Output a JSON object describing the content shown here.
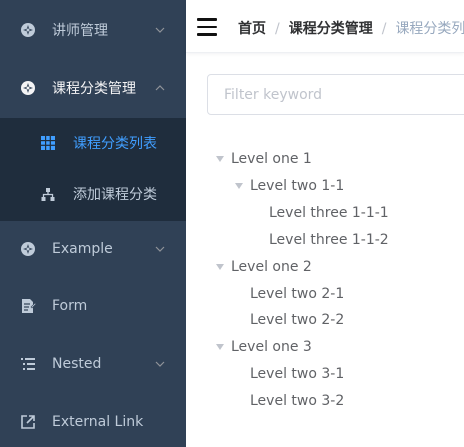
{
  "sidebar": {
    "items": [
      {
        "label": "讲师管理",
        "icon": "example-icon",
        "expanded": false
      },
      {
        "label": "课程分类管理",
        "icon": "example-icon",
        "expanded": true,
        "children": [
          {
            "label": "课程分类列表",
            "icon": "table-icon",
            "active": true
          },
          {
            "label": "添加课程分类",
            "icon": "tree-icon",
            "active": false
          }
        ]
      },
      {
        "label": "Example",
        "icon": "example-icon",
        "expanded": false
      },
      {
        "label": "Form",
        "icon": "form-icon"
      },
      {
        "label": "Nested",
        "icon": "nested-icon",
        "expanded": false
      },
      {
        "label": "External Link",
        "icon": "link-icon"
      }
    ]
  },
  "navbar": {
    "breadcrumb": [
      "首页",
      "课程分类管理",
      "课程分类列表"
    ]
  },
  "filter": {
    "placeholder": "Filter keyword",
    "value": ""
  },
  "tree": [
    {
      "label": "Level one 1",
      "expanded": true,
      "children": [
        {
          "label": "Level two 1-1",
          "expanded": true,
          "children": [
            {
              "label": "Level three 1-1-1"
            },
            {
              "label": "Level three 1-1-2"
            }
          ]
        }
      ]
    },
    {
      "label": "Level one 2",
      "expanded": true,
      "children": [
        {
          "label": "Level two 2-1"
        },
        {
          "label": "Level two 2-2"
        }
      ]
    },
    {
      "label": "Level one 3",
      "expanded": true,
      "children": [
        {
          "label": "Level two 3-1"
        },
        {
          "label": "Level two 3-2"
        }
      ]
    }
  ],
  "colors": {
    "sidebar_bg": "#304156",
    "submenu_bg": "#1f2d3d",
    "sidebar_text": "#bfcbd9",
    "active_text": "#409eff"
  }
}
